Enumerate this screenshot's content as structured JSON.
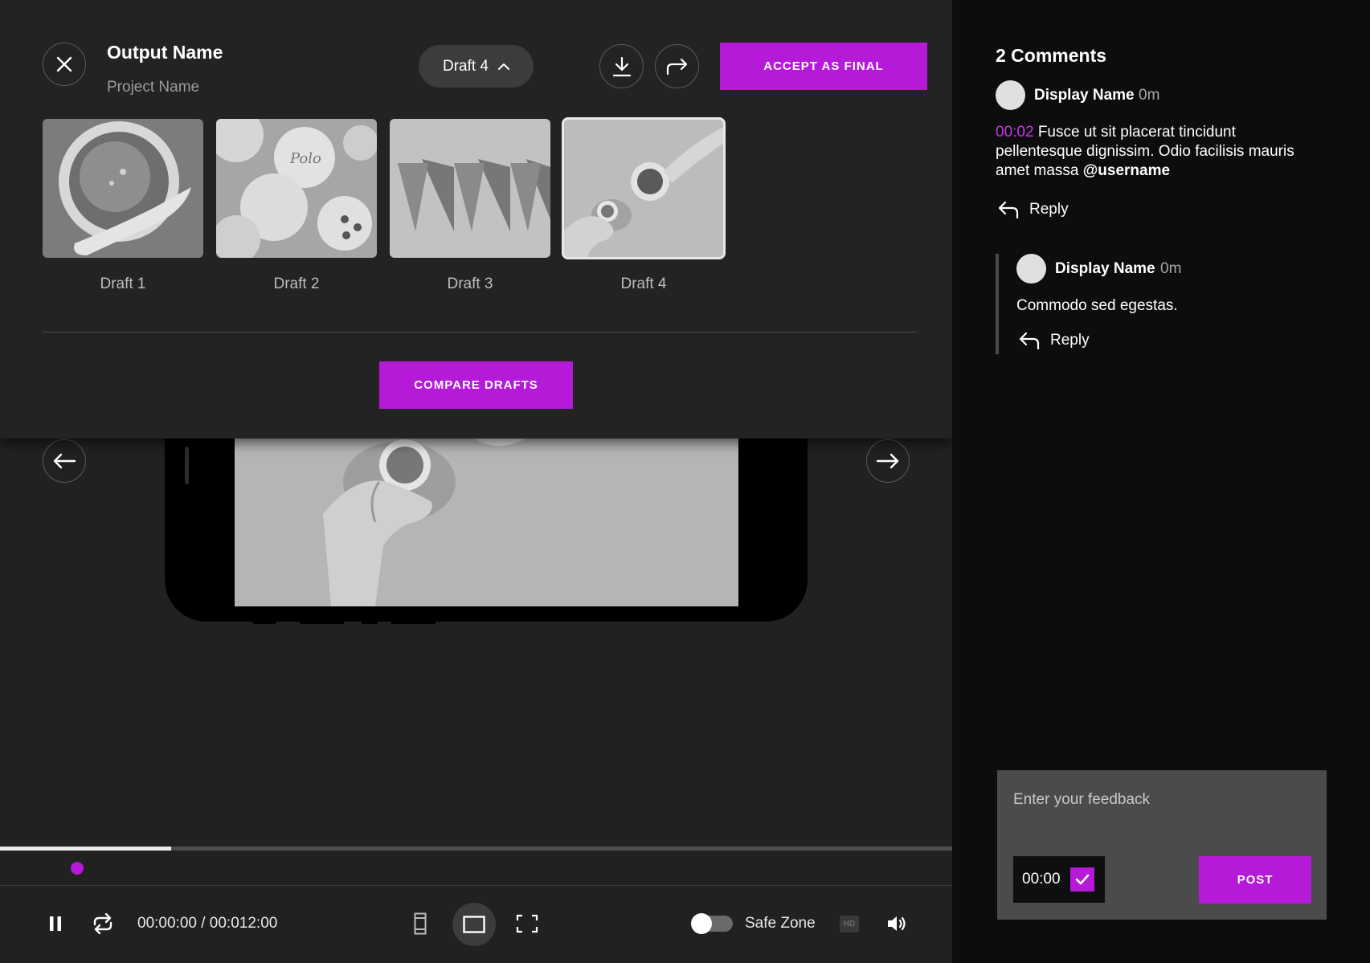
{
  "header": {
    "output_name": "Output Name",
    "project_name": "Project Name",
    "draft_selector": "Draft 4",
    "accept_label": "ACCEPT AS FINAL"
  },
  "drafts": [
    {
      "label": "Draft 1",
      "selected": false
    },
    {
      "label": "Draft 2",
      "selected": false
    },
    {
      "label": "Draft 3",
      "selected": false
    },
    {
      "label": "Draft 4",
      "selected": true
    }
  ],
  "compare_label": "COMPARE DRAFTS",
  "player": {
    "timecode": "00:00:00 / 00:012:00",
    "progress": 0.18,
    "safe_zone_label": "Safe Zone",
    "safe_zone_on": false,
    "hd_badge": "HD"
  },
  "comments": {
    "title": "2 Comments",
    "items": [
      {
        "author": "Display Name",
        "time_ago": "0m",
        "timestamp": "00:02",
        "text": "Fusce ut sit placerat tincidunt pellentesque dignissim. Odio facilisis mauris amet massa",
        "mention": "@username",
        "reply_label": "Reply"
      },
      {
        "author": "Display Name",
        "time_ago": "0m",
        "text": "Commodo sed egestas.",
        "reply_label": "Reply"
      }
    ]
  },
  "feedback": {
    "placeholder": "Enter your feedback",
    "timestamp": "00:00",
    "post_label": "POST"
  },
  "colors": {
    "accent": "#b51ad8",
    "panel": "#232324",
    "sidebar": "#0d0d0d"
  }
}
